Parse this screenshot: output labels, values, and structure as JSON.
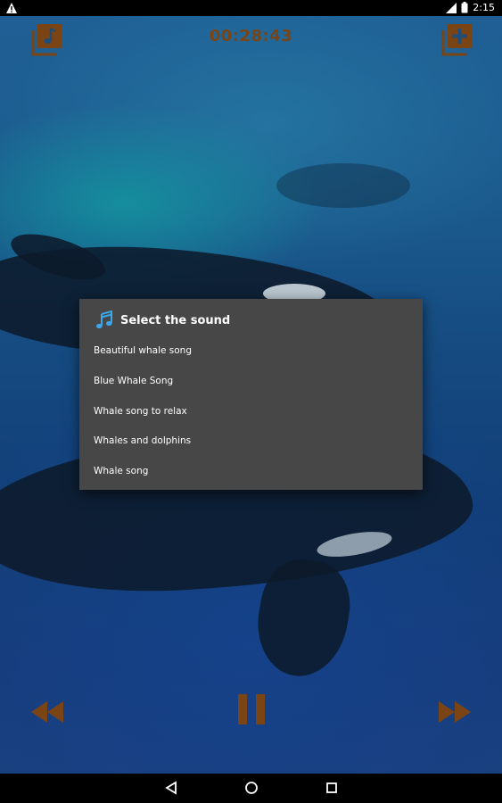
{
  "status_bar": {
    "time": "2:15"
  },
  "top_bar": {
    "timer": "00:28:43"
  },
  "dialog": {
    "title": "Select the sound",
    "items": [
      {
        "label": "Beautiful whale song"
      },
      {
        "label": "Blue Whale Song"
      },
      {
        "label": "Whale song to relax"
      },
      {
        "label": "Whales and dolphins"
      },
      {
        "label": "Whale song"
      }
    ]
  },
  "icons": {
    "playlist": "music-library-icon",
    "add": "add-library-icon",
    "rewind": "rewind-icon",
    "pause": "pause-icon",
    "forward": "fast-forward-icon",
    "title_note": "music-note-icon"
  },
  "colors": {
    "accent": "#7a4414",
    "dialog_bg": "#474747",
    "note_blue": "#3ba7e8"
  }
}
